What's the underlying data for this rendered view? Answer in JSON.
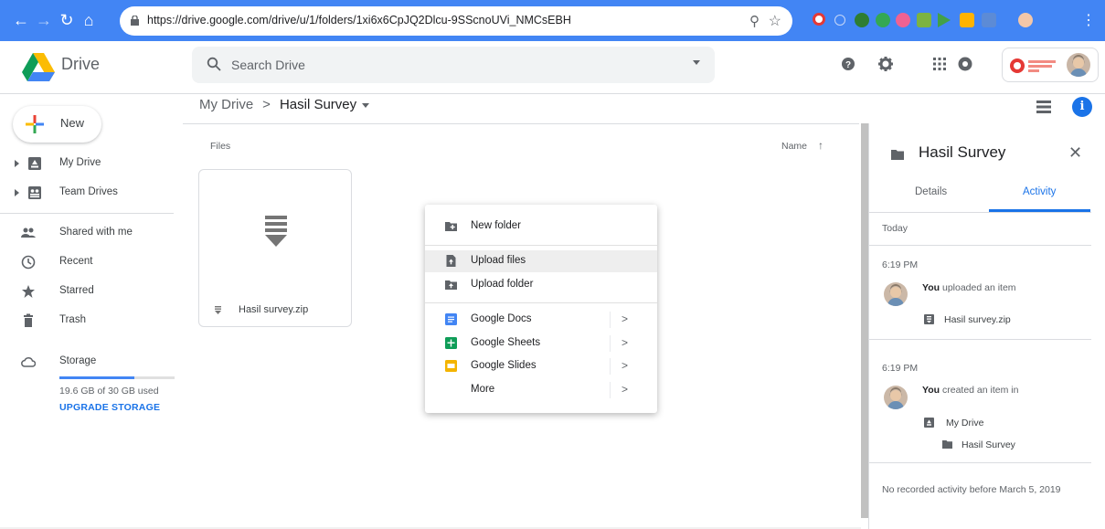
{
  "browser": {
    "url": "https://drive.google.com/drive/u/1/folders/1xi6x6CpJQ2Dlcu-9SScnoUVi_NMCsEBH"
  },
  "app": {
    "name": "Drive",
    "search_placeholder": "Search Drive"
  },
  "breadcrumb": {
    "root": "My Drive",
    "separator": ">",
    "current": "Hasil Survey"
  },
  "sidebar": {
    "new_label": "New",
    "items": [
      {
        "label": "My Drive",
        "icon": "my-drive-icon"
      },
      {
        "label": "Team Drives",
        "icon": "team-drives-icon"
      },
      {
        "label": "Shared with me",
        "icon": "people-icon"
      },
      {
        "label": "Recent",
        "icon": "clock-icon"
      },
      {
        "label": "Starred",
        "icon": "star-icon"
      },
      {
        "label": "Trash",
        "icon": "trash-icon"
      },
      {
        "label": "Storage",
        "icon": "cloud-icon"
      }
    ],
    "storage_used": "19.6 GB of 30 GB used",
    "storage_fraction": 0.653,
    "upgrade_label": "UPGRADE STORAGE"
  },
  "main": {
    "section_label": "Files",
    "sort_label": "Name",
    "sort_direction": "ascending",
    "files": [
      {
        "name": "Hasil survey.zip",
        "icon": "zip-icon"
      }
    ]
  },
  "context_menu": {
    "items": [
      {
        "label": "New folder",
        "icon": "new-folder-icon"
      },
      {
        "label": "Upload files",
        "icon": "upload-file-icon",
        "highlighted": true
      },
      {
        "label": "Upload folder",
        "icon": "upload-folder-icon"
      },
      {
        "label": "Google Docs",
        "icon": "docs-icon",
        "submenu": ">"
      },
      {
        "label": "Google Sheets",
        "icon": "sheets-icon",
        "submenu": ">"
      },
      {
        "label": "Google Slides",
        "icon": "slides-icon",
        "submenu": ">"
      },
      {
        "label": "More",
        "icon": "",
        "submenu": ">"
      }
    ]
  },
  "details_panel": {
    "title": "Hasil Survey",
    "tabs": [
      "Details",
      "Activity"
    ],
    "active_tab": "Activity",
    "today_label": "Today",
    "activities": [
      {
        "time": "6:19 PM",
        "actor": "You",
        "text": " uploaded an item",
        "item": "Hasil survey.zip"
      },
      {
        "time": "6:19 PM",
        "actor": "You",
        "text": " created an item in",
        "parent": "My Drive",
        "item": "Hasil Survey"
      }
    ],
    "footer": "No recorded activity before March 5, 2019"
  },
  "colors": {
    "chrome": "#4285f4",
    "accent": "#1a73e8",
    "docs": "#4285f4",
    "sheets": "#0f9d58",
    "slides": "#f4b400"
  }
}
